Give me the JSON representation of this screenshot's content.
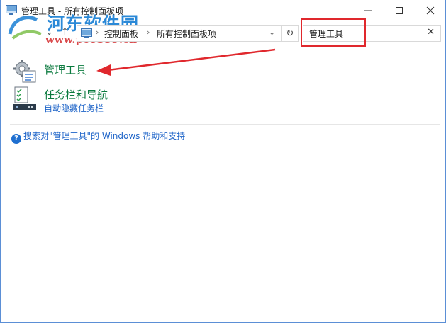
{
  "window": {
    "title": "管理工具 - 所有控制面板项"
  },
  "watermark": {
    "logo_text": "河东软件园",
    "url_text": "www.pc0359.cn"
  },
  "address": {
    "crumbs": [
      "控制面板",
      "所有控制面板项"
    ]
  },
  "search": {
    "value": "管理工具",
    "clear_glyph": "✕"
  },
  "results": [
    {
      "title": "管理工具",
      "subtitle": ""
    },
    {
      "title": "任务栏和导航",
      "subtitle": "自动隐藏任务栏"
    }
  ],
  "help": {
    "icon_glyph": "?",
    "text": "搜索对\"管理工具\"的 Windows 帮助和支持"
  },
  "colors": {
    "highlight": "#e0282d",
    "link_green": "#0a7a3e",
    "link_blue": "#1e64c8"
  }
}
